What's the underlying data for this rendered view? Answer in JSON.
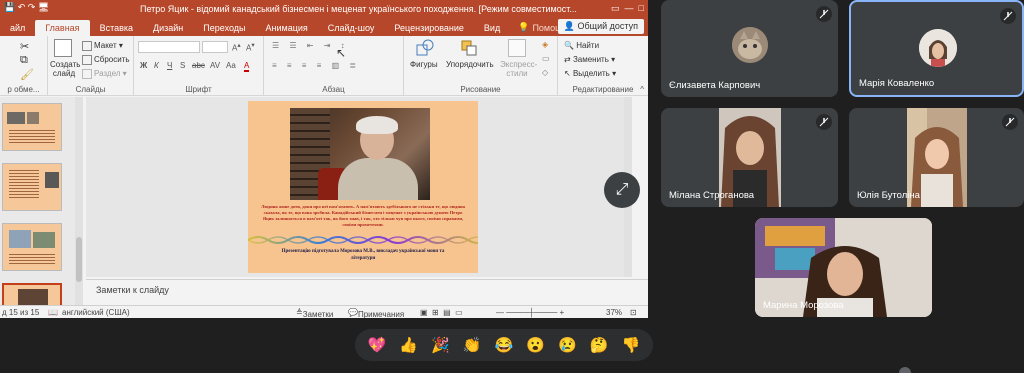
{
  "ppt": {
    "title": "Петро Яцик - відомий канадський бізнесмен і меценат українського походження. [Режим совместимост...",
    "tabs": [
      "айл",
      "Главная",
      "Вставка",
      "Дизайн",
      "Переходы",
      "Анимация",
      "Слайд-шоу",
      "Рецензирование",
      "Вид"
    ],
    "help_label": "Помощник...",
    "share_label": "Общий доступ",
    "ribbon": {
      "clipboard_label": "р обме...",
      "create_slide": "Создать слайд",
      "maket": "Макет",
      "reset": "Сбросить",
      "section": "Раздел",
      "slides_group": "Слайды",
      "font_group": "Шрифт",
      "paragraph_group": "Абзац",
      "shapes": "Фигуры",
      "arrange": "Упорядочить",
      "express_styles": "Экспресс-стили",
      "drawing_group": "Рисование",
      "find": "Найти",
      "replace": "Заменить",
      "select": "Выделить",
      "editing_group": "Редактирование",
      "font_format_buttons": [
        "Ж",
        "К",
        "Ч",
        "S",
        "abc",
        "AV",
        "Aa",
        "A"
      ]
    },
    "slide": {
      "quote": "Людина живе доти, доки про неї пам'ятають. А пам'ятають здебільшого не стільки те, що людина сказала, як те, що вона зробила. Канадійський бізнесмен і меценат з українською душею Петро Яцик залишається в пам'яті так, як його знав, і так, хто тільки чув про нього, своїми справами, своїми прометеями.",
      "credit": "Презентацію підготувала Морозова М.В., викладач української мови та літератури"
    },
    "notes_placeholder": "Заметки к слайду",
    "status": {
      "slide_counter": "д 15 из 15",
      "language": "английский (США)",
      "notes_btn": "Заметки",
      "comments_btn": "Примечания",
      "zoom": "37%"
    }
  },
  "participants": [
    {
      "name": "Єлизавета Карпович",
      "muted": true,
      "active": false
    },
    {
      "name": "Марія Коваленко",
      "muted": true,
      "active": true
    },
    {
      "name": "Мілана Строганова",
      "muted": true,
      "active": false
    },
    {
      "name": "Юлія Бутоліна",
      "muted": true,
      "active": false
    },
    {
      "name": "Марина Морозова",
      "muted": false,
      "active": false
    }
  ],
  "reactions": [
    "💖",
    "👍",
    "🎉",
    "👏",
    "😂",
    "😮",
    "😢",
    "🤔",
    "👎"
  ],
  "colors": {
    "ppt_accent": "#b7472a",
    "meet_bg": "#1f1f1f",
    "tile_bg": "#3c4043",
    "active_border": "#8ab4f8"
  }
}
